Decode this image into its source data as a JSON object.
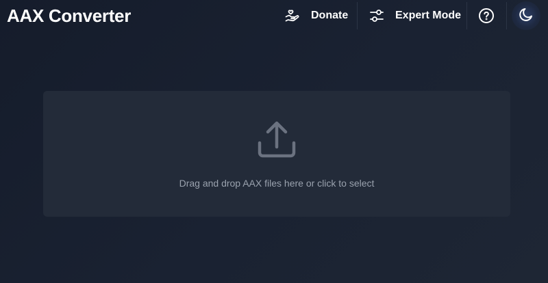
{
  "app": {
    "title": "AAX Converter"
  },
  "header": {
    "donate_label": "Donate",
    "expert_mode_label": "Expert Mode",
    "icons": {
      "donate": "hand-heart-icon",
      "expert_mode": "sliders-icon",
      "help": "question-circle-icon",
      "theme": "moon-icon"
    }
  },
  "dropzone": {
    "text": "Drag and drop AAX files here or click to select",
    "icon": "upload-icon"
  },
  "colors": {
    "background": "#1a2232",
    "dropzone": "#232b39",
    "text_primary": "#ffffff",
    "text_muted": "#9aa2ae",
    "icon_muted": "#6b7280"
  }
}
